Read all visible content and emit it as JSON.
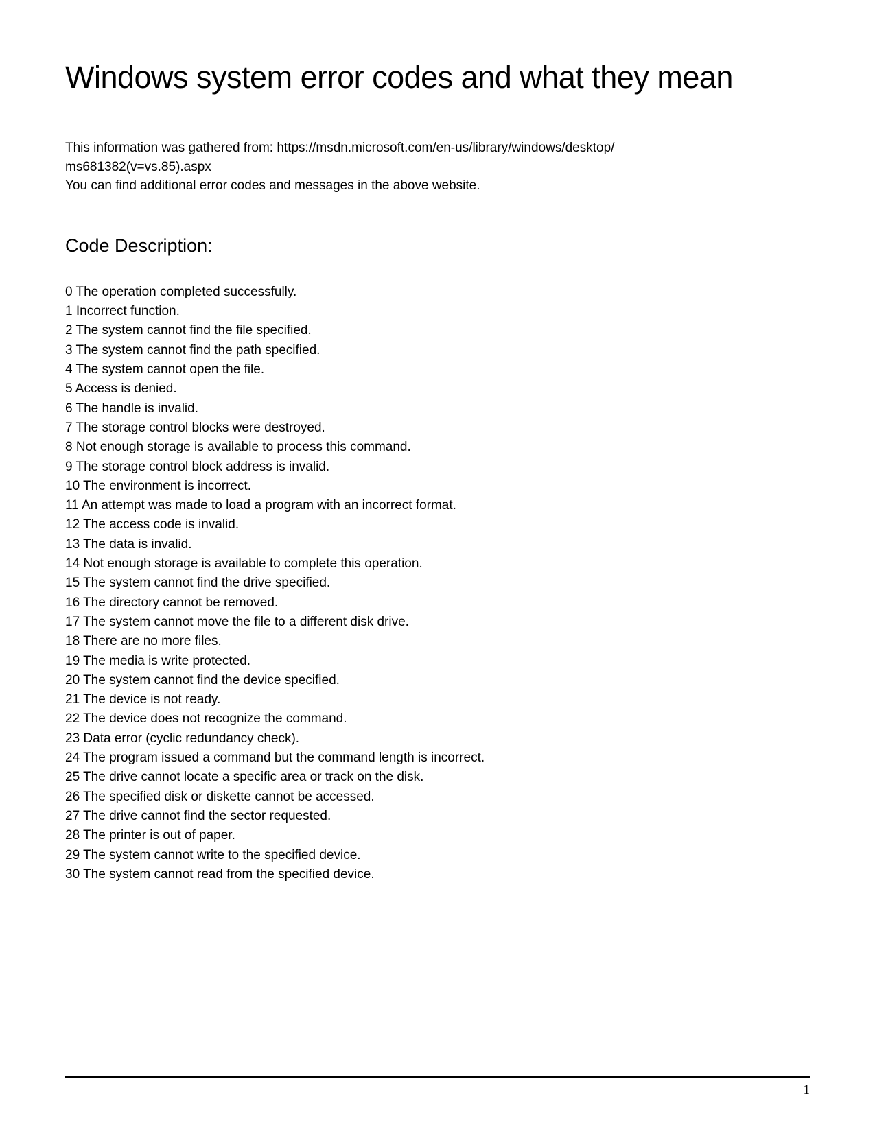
{
  "title": "Windows system error codes and what they mean",
  "intro_line1": "This information was gathered from: https://msdn.microsoft.com/en-us/library/windows/desktop/",
  "intro_line2": "ms681382(v=vs.85).aspx",
  "intro_line3": "You can find additional error codes and messages in the above website.",
  "section_heading": "Code Description:",
  "codes": [
    {
      "code": "0",
      "desc": "The operation completed successfully."
    },
    {
      "code": "1",
      "desc": "Incorrect function."
    },
    {
      "code": "2",
      "desc": "The system cannot find the file specified."
    },
    {
      "code": "3",
      "desc": "The system cannot find the path specified."
    },
    {
      "code": "4",
      "desc": "The system cannot open the file."
    },
    {
      "code": "5",
      "desc": "Access is denied."
    },
    {
      "code": "6",
      "desc": "The handle is invalid."
    },
    {
      "code": "7",
      "desc": "The storage control blocks were destroyed."
    },
    {
      "code": "8",
      "desc": "Not enough storage is available to process this command."
    },
    {
      "code": "9",
      "desc": "The storage control block address is invalid."
    },
    {
      "code": "10",
      "desc": "The environment is incorrect."
    },
    {
      "code": "11",
      "desc": "An attempt was made to load a program with an incorrect format."
    },
    {
      "code": "12",
      "desc": "The access code is invalid."
    },
    {
      "code": "13",
      "desc": "The data is invalid."
    },
    {
      "code": "14",
      "desc": "Not enough storage is available to complete this operation."
    },
    {
      "code": "15",
      "desc": "The system cannot find the drive specified."
    },
    {
      "code": "16",
      "desc": "The directory cannot be removed."
    },
    {
      "code": "17",
      "desc": "The system cannot move the file to a different disk drive."
    },
    {
      "code": "18",
      "desc": "There are no more files."
    },
    {
      "code": "19",
      "desc": "The media is write protected."
    },
    {
      "code": "20",
      "desc": "The system cannot find the device specified."
    },
    {
      "code": "21",
      "desc": "The device is not ready."
    },
    {
      "code": "22",
      "desc": "The device does not recognize the command."
    },
    {
      "code": "23",
      "desc": "Data error (cyclic redundancy check)."
    },
    {
      "code": "24",
      "desc": "The program issued a command but the command length is incorrect."
    },
    {
      "code": "25",
      "desc": "The drive cannot locate a specific area or track on the disk."
    },
    {
      "code": "26",
      "desc": "The specified disk or diskette cannot be accessed."
    },
    {
      "code": "27",
      "desc": "The drive cannot find the sector requested."
    },
    {
      "code": "28",
      "desc": "The printer is out of paper."
    },
    {
      "code": "29",
      "desc": "The system cannot write to the specified device."
    },
    {
      "code": "30",
      "desc": "The system cannot read from the specified device."
    }
  ],
  "page_number": "1"
}
